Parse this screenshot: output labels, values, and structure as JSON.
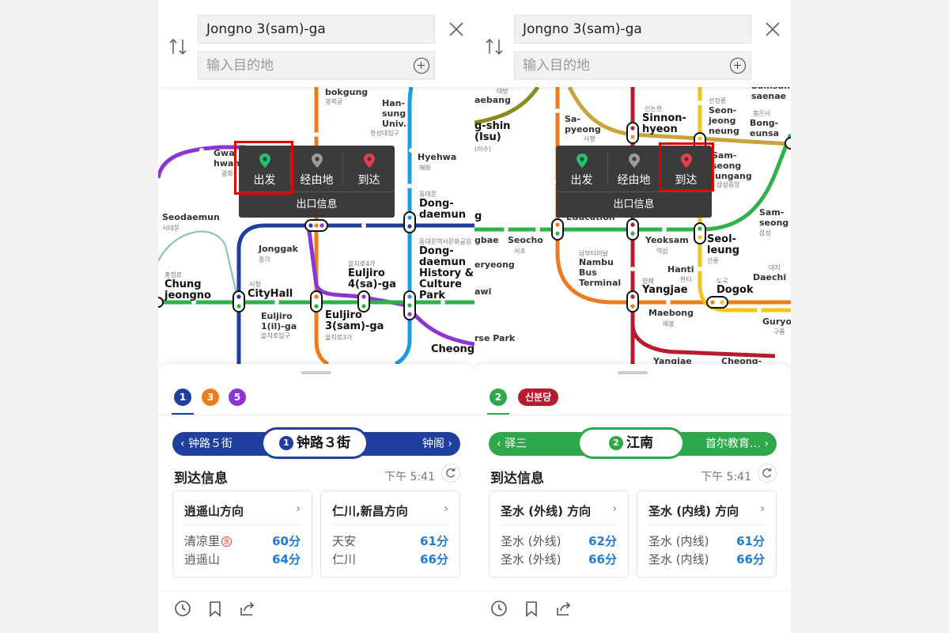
{
  "panels": [
    {
      "origin": "Jongno 3(sam)-ga",
      "destination_placeholder": "输入目的地",
      "popup": {
        "depart": "出发",
        "via": "经由地",
        "arrive": "到达",
        "exit_info": "出口信息",
        "highlighted": "depart"
      },
      "map_labels": {
        "gyeongbokgung": "bokgung",
        "gyeongbokgung_ko": "경복궁",
        "hansung": "Han-\nsung\nUniv.",
        "hansung_ko": "한성대입구",
        "gwanghwamun": "Gwa\nhwan",
        "gwanghwamun_ko": "광화",
        "hyehwa": "Hyehwa",
        "hyehwa_ko": "혜화",
        "dongdaemun_ko": "동대문",
        "dongdaemun": "Dong-\ndaemun",
        "seodaemun": "Seodaemun",
        "seodaemun_ko": "서대문",
        "jonggak": "Jonggak",
        "jonggak_ko": "종각",
        "ddp_ko": "동대문역사문화공원",
        "ddp": "Dong-\ndaemun\nHistory &\nCulture\nPark",
        "euljiro4_ko": "을지로4가",
        "euljiro4": "Euljiro\n4(sa)-ga",
        "chungjeongno_ko": "충정로",
        "chungjeongno": "Chung\njeongno",
        "cityhall_ko": "시청",
        "cityhall": "CityHall",
        "euljiro1": "Euljiro\n1(il)-ga",
        "euljiro1_ko": "을지로입구",
        "euljiro3": "Euljiro\n3(sam)-ga",
        "euljiro3_ko": "을지로3가",
        "cheonggu": "Cheonggu"
      },
      "line_tabs": [
        {
          "label": "1",
          "color": "#1f3fa0"
        },
        {
          "label": "3",
          "color": "#ef7c1c"
        },
        {
          "label": "5",
          "color": "#8a36d6"
        }
      ],
      "nav": {
        "prev": "钟路５街",
        "current_num": "1",
        "current": "钟路３街",
        "next": "钟阁",
        "color": "#1f3fa0"
      },
      "arrival_title": "到达信息",
      "time": "下午 5:41",
      "cards": [
        {
          "title": "逍遥山方向",
          "rows": [
            {
              "name": "清凉里",
              "min": "60分",
              "express": "急"
            },
            {
              "name": "逍遥山",
              "min": "64分"
            }
          ]
        },
        {
          "title": "仁川,新昌方向",
          "rows": [
            {
              "name": "天安",
              "min": "61分"
            },
            {
              "name": "仁川",
              "min": "66分"
            }
          ]
        }
      ]
    },
    {
      "origin": "Jongno 3(sam)-ga",
      "destination_placeholder": "输入目的地",
      "popup": {
        "depart": "出发",
        "via": "经由地",
        "arrive": "到达",
        "exit_info": "出口信息",
        "highlighted": "arrive"
      },
      "map_labels": {
        "daebang_ko": "대방",
        "daebang": "aebang",
        "sinnonhyeon_ko": "신논현",
        "sinnonhyeon": "Sinnon-\nhyeon",
        "seonjeongneung_ko": "선정릉",
        "seonjeongneung": "Seon-\njeong\nneung",
        "samseongjungang_ko": "봉은사",
        "bongeunsa": "Bong-\neunsa",
        "samsung_top": "Samsun\nsaenae",
        "isu": "g-shin\n(Isu)",
        "isu_ko": "(이수)",
        "sapyeong": "Sa-\npyeong",
        "sapyeong_ko": "사평",
        "samseongjungang": "Sam-\nseong\nJungang",
        "samseongjungang_ko2": "삼성중앙",
        "education": "Education",
        "samseong": "Sam-\nseong",
        "samseong_ko": "삼성",
        "g": "g",
        "gbae": "gbae",
        "seocho": "Seocho",
        "seocho_ko": "서초",
        "nambu_ko": "남부터미널",
        "nambu": "Nambu\nBus\nTerminal",
        "yeoksam": "Yeoksam",
        "yeoksam_ko": "역삼",
        "seolleung": "Seol-\nleung",
        "seolleung_ko": "선릉",
        "eryeong": "eryeong",
        "hanti": "Hanti",
        "hanti_ko": "한티",
        "daechi_ko": "대치",
        "daechi": "Daechi",
        "yangjae_ko": "양재",
        "yangjae": "Yangjae",
        "dogok_ko": "도곡",
        "dogok": "Dogok",
        "awi": "awi",
        "maebong": "Maebong",
        "maebong_ko": "매봉",
        "guryong": "Guryon",
        "guryong_ko": "구룡",
        "rsepark": "rse Park",
        "yangjae2": "Yangjae",
        "cheong": "Cheong-"
      },
      "line_tabs": [
        {
          "label": "2",
          "color": "#2ea84a"
        },
        {
          "label": "신분당",
          "color": "#b71c2e"
        }
      ],
      "nav": {
        "prev": "驿三",
        "current_num": "2",
        "current": "江南",
        "next": "首尔教育…",
        "color": "#2ea84a"
      },
      "arrival_title": "到达信息",
      "time": "下午 5:41",
      "cards": [
        {
          "title": "圣水 (外线) 方向",
          "rows": [
            {
              "name": "圣水 (外线)",
              "min": "62分"
            },
            {
              "name": "圣水 (外线)",
              "min": "66分"
            }
          ]
        },
        {
          "title": "圣水 (内线) 方向",
          "rows": [
            {
              "name": "圣水 (内线)",
              "min": "61分"
            },
            {
              "name": "圣水 (内线)",
              "min": "66分"
            }
          ]
        }
      ]
    }
  ]
}
